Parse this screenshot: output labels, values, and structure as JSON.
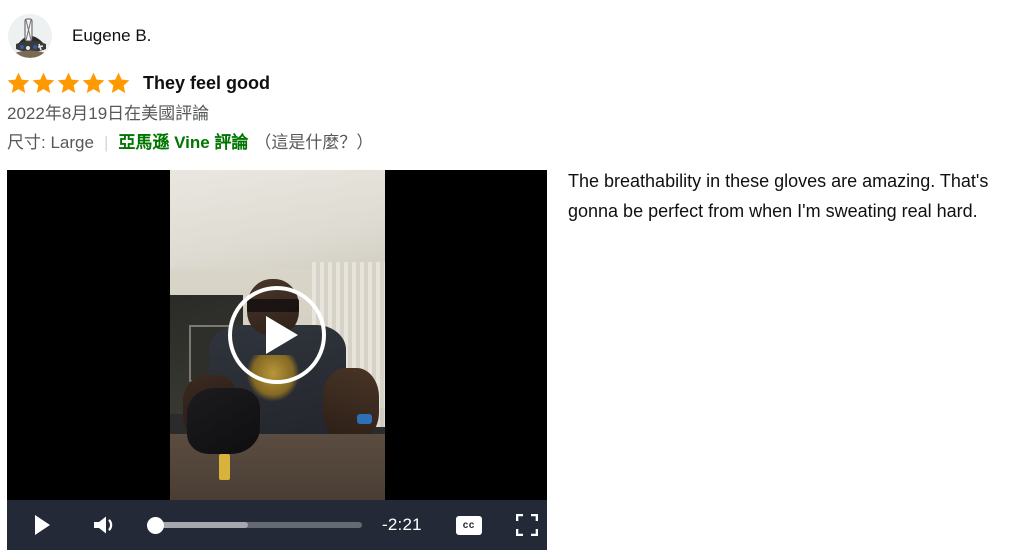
{
  "review": {
    "profile": {
      "name": "Eugene B.",
      "avatar_icon": "user-avatar-image"
    },
    "rating": {
      "stars_filled": 5,
      "stars_total": 5,
      "star_color": "#FF9900"
    },
    "title": "They feel good",
    "date_line": "2022年8月19日在美國評論",
    "meta": {
      "size_label": "尺寸: Large",
      "divider": "|",
      "vine_badge": "亞馬遜 Vine 評論",
      "vine_help": "（這是什麼？）",
      "vine_color": "#007600"
    },
    "body_text": " The breathability in these gloves are amazing. That's gonna be perfect from when I'm sweating real hard."
  },
  "video_player": {
    "play_overlay_icon": "play-circle-icon",
    "controls": {
      "play_icon": "play-icon",
      "volume_icon": "volume-on-icon",
      "progress_percent": 0,
      "buffered_percent": 47,
      "time_remaining": "-2:21",
      "cc_label": "cc",
      "cc_icon": "closed-captions-icon",
      "fullscreen_icon": "fullscreen-icon",
      "bar_color": "#232936"
    }
  }
}
